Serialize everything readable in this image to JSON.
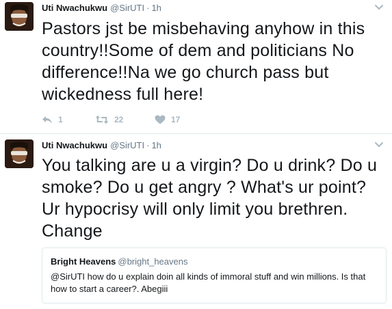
{
  "tweets": [
    {
      "author_name": "Uti Nwachukwu",
      "author_handle": "@SirUTI",
      "separator": "·",
      "time": "1h",
      "text": "Pastors jst be misbehaving anyhow in this country!!Some of dem and politicians No difference!!Na we go church pass but wickedness full here!",
      "reply_count": "1",
      "retweet_count": "22",
      "like_count": "17"
    },
    {
      "author_name": "Uti Nwachukwu",
      "author_handle": "@SirUTI",
      "separator": "·",
      "time": "1h",
      "text": "You talking are u a virgin? Do u drink? Do u smoke? Do u get angry ? What's ur point? Ur hypocrisy will only limit you brethren. Change",
      "quoted": {
        "author_name": "Bright Heavens",
        "author_handle": "@bright_heavens",
        "text": "@SirUTI how do u explain doin all kinds of immoral stuff and win millions. Is that how to start a career?. Abegiii"
      }
    }
  ],
  "icons": {
    "reply": "reply-icon",
    "retweet": "retweet-icon",
    "like": "heart-icon",
    "menu": "chevron-down-icon"
  },
  "colors": {
    "text": "#14171a",
    "muted": "#657786",
    "action_icon": "#aab8c2",
    "divider": "#e1e8ed"
  }
}
